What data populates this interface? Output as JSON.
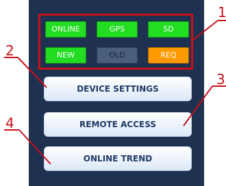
{
  "status_indicators": [
    {
      "label": "ONLINE",
      "state": "active",
      "color": "#22dd22"
    },
    {
      "label": "GPS",
      "state": "active",
      "color": "#22dd22"
    },
    {
      "label": "SD",
      "state": "active",
      "color": "#22dd22"
    },
    {
      "label": "NEW",
      "state": "active",
      "color": "#22dd22"
    },
    {
      "label": "OLD",
      "state": "inactive",
      "color": "#4a5f7d"
    },
    {
      "label": "REQ",
      "state": "warning",
      "color": "#ff9900"
    }
  ],
  "actions": {
    "device_settings": "DEVICE SETTINGS",
    "remote_access": "REMOTE ACCESS",
    "online_trend": "ONLINE TREND"
  },
  "callouts": [
    "1",
    "2",
    "3",
    "4"
  ],
  "colors": {
    "panel_bg": "#1e3150",
    "callout_red": "#c8101a",
    "button_text": "#1f3a66"
  }
}
